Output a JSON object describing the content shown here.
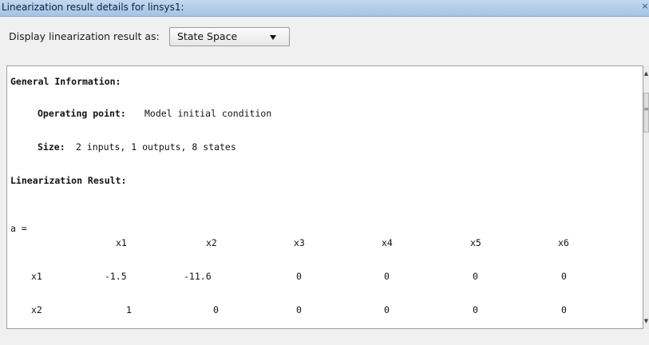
{
  "window": {
    "title": "Linearization result details for linsys1:",
    "close_glyph": "×"
  },
  "display": {
    "label": "Display linearization result as:",
    "selected": "State Space"
  },
  "report": {
    "general_heading": "General Information:",
    "operating_point_label": "Operating point:",
    "operating_point_value": "Model initial condition",
    "size_label": "Size:",
    "size_value": "2 inputs, 1 outputs, 8 states",
    "result_heading": "Linearization Result:",
    "matrix_name": "a =",
    "columns": [
      "x1",
      "x2",
      "x3",
      "x4",
      "x5",
      "x6"
    ],
    "rows": [
      {
        "label": "x1",
        "values": [
          "-1.5",
          "-11.6",
          "0",
          "0",
          "0",
          "0"
        ]
      },
      {
        "label": "x2",
        "values": [
          "1",
          "0",
          "0",
          "0",
          "0",
          "0"
        ]
      }
    ]
  },
  "scrollbar": {
    "up_glyph": "▲",
    "down_glyph": "▼",
    "grip_glyph": "≡"
  }
}
